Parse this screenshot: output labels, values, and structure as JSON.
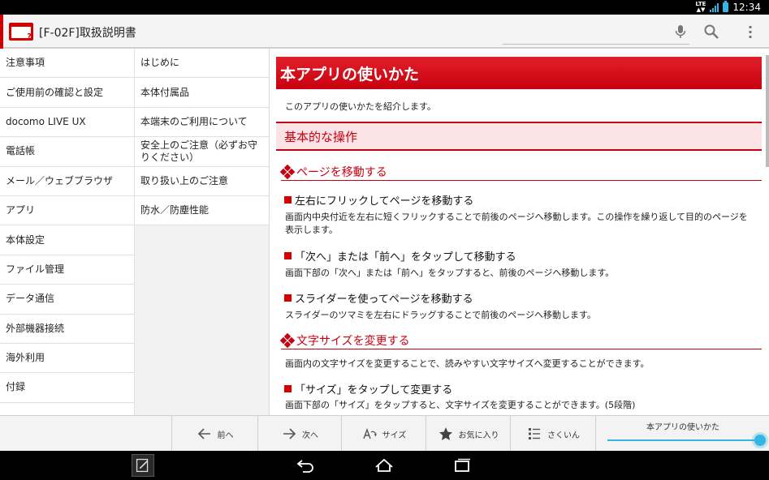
{
  "status_bar": {
    "network": "LTE",
    "time": "12:34"
  },
  "app": {
    "title": "[F-02F]取扱説明書"
  },
  "menu_primary": [
    "注意事項",
    "ご使用前の確認と設定",
    "docomo LIVE UX",
    "電話帳",
    "メール／ウェブブラウザ",
    "アプリ",
    "本体設定",
    "ファイル管理",
    "データ通信",
    "外部機器接続",
    "海外利用",
    "付録"
  ],
  "menu_secondary": [
    "はじめに",
    "本体付属品",
    "本端末のご利用について",
    "安全上のご注意（必ずお守りください）",
    "取り扱い上のご注意",
    "防水／防塵性能"
  ],
  "content": {
    "heading": "本アプリの使いかた",
    "intro": "このアプリの使いかたを紹介します。",
    "subheading": "基本的な操作",
    "section1": {
      "title": "ページを移動する",
      "items": [
        {
          "title": "左右にフリックしてページを移動する",
          "text": "画面内中央付近を左右に短くフリックすることで前後のページへ移動します。この操作を繰り返して目的のページを表示します。"
        },
        {
          "title": "「次へ」または「前へ」をタップして移動する",
          "text": "画面下部の「次へ」または「前へ」をタップすると、前後のページへ移動します。"
        },
        {
          "title": "スライダーを使ってページを移動する",
          "text": "スライダーのツマミを左右にドラッグすることで前後のページへ移動します。"
        }
      ]
    },
    "section2": {
      "title": "文字サイズを変更する",
      "intro": "画面内の文字サイズを変更することで、読みやすい文字サイズへ変更することができます。",
      "items": [
        {
          "title": "「サイズ」をタップして変更する",
          "text": "画面下部の「サイズ」をタップすると、文字サイズを変更することができます。(5段階)"
        }
      ]
    }
  },
  "toolbar": {
    "prev": "前へ",
    "next": "次へ",
    "size": "サイズ",
    "favorite": "お気に入り",
    "index": "さくいん",
    "slider_label": "本アプリの使いかた",
    "slider_position": 1.0
  },
  "colors": {
    "accent": "#c8000f",
    "slider": "#33b5e5"
  }
}
